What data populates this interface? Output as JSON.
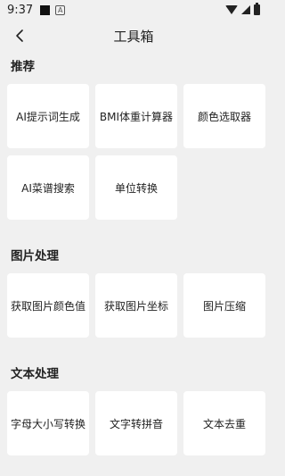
{
  "statusbar": {
    "time": "9:37",
    "app_icon_letter": "A"
  },
  "appbar": {
    "title": "工具箱"
  },
  "sections": [
    {
      "title": "推荐",
      "items": [
        "AI提示词生成",
        "BMI体重计算器",
        "颜色选取器",
        "AI菜谱搜索",
        "单位转换"
      ]
    },
    {
      "title": "图片处理",
      "items": [
        "获取图片颜色值",
        "获取图片坐标",
        "图片压缩"
      ]
    },
    {
      "title": "文本处理",
      "items": [
        "字母大小写转换",
        "文字转拼音",
        "文本去重"
      ]
    }
  ]
}
